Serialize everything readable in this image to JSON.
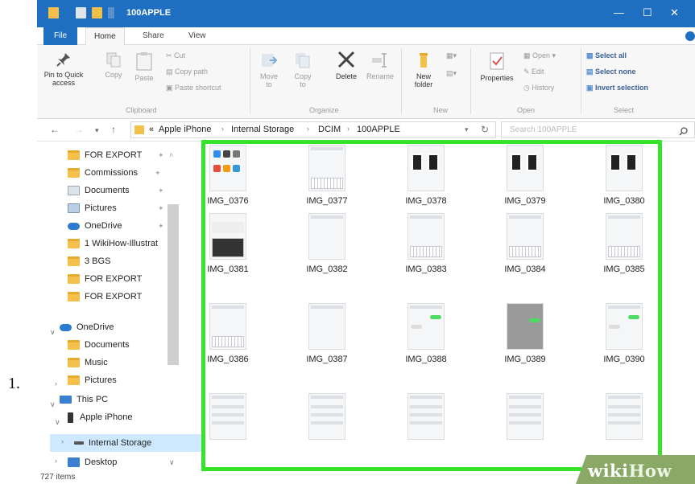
{
  "step_number": "1.",
  "window": {
    "title": "100APPLE",
    "controls": {
      "minimize": "—",
      "maximize": "☐",
      "close": "✕"
    }
  },
  "tabs": {
    "file": "File",
    "home": "Home",
    "share": "Share",
    "view": "View"
  },
  "ribbon": {
    "clipboard": {
      "group": "Clipboard",
      "pin_line1": "Pin to Quick",
      "pin_line2": "access",
      "copy": "Copy",
      "paste": "Paste",
      "cut": "Cut",
      "copy_path": "Copy path",
      "paste_shortcut": "Paste shortcut"
    },
    "organize": {
      "group": "Organize",
      "move_to_line1": "Move",
      "move_to_line2": "to",
      "copy_to_line1": "Copy",
      "copy_to_line2": "to",
      "delete": "Delete",
      "rename": "Rename"
    },
    "new": {
      "group": "New",
      "new_folder_line1": "New",
      "new_folder_line2": "folder"
    },
    "open": {
      "group": "Open",
      "properties": "Properties",
      "open": "Open",
      "edit": "Edit",
      "history": "History"
    },
    "select": {
      "group": "Select",
      "select_all": "Select all",
      "select_none": "Select none",
      "invert_selection": "Invert selection"
    }
  },
  "address": {
    "breadcrumb": [
      "Apple iPhone",
      "Internal Storage",
      "DCIM",
      "100APPLE"
    ],
    "overflow": "«",
    "search_placeholder": "Search 100APPLE"
  },
  "nav": {
    "quick_access": [
      {
        "label": "FOR EXPORT",
        "icon": "folder"
      },
      {
        "label": "Commissions",
        "icon": "folder"
      },
      {
        "label": "Documents",
        "icon": "documents"
      },
      {
        "label": "Pictures",
        "icon": "pictures"
      },
      {
        "label": "OneDrive",
        "icon": "onedrive"
      },
      {
        "label": "1 WikiHow-Illustrat",
        "icon": "folder"
      },
      {
        "label": "3 BGS",
        "icon": "folder"
      },
      {
        "label": "FOR EXPORT",
        "icon": "folder"
      },
      {
        "label": "FOR EXPORT",
        "icon": "folder"
      }
    ],
    "onedrive": {
      "label": "OneDrive",
      "children": [
        "Documents",
        "Music",
        "Pictures"
      ]
    },
    "this_pc": {
      "label": "This PC",
      "apple_iphone": "Apple iPhone",
      "internal_storage": "Internal Storage",
      "desktop": "Desktop"
    }
  },
  "files": [
    "IMG_0376",
    "IMG_0377",
    "IMG_0378",
    "IMG_0379",
    "IMG_0380",
    "IMG_0381",
    "IMG_0382",
    "IMG_0383",
    "IMG_0384",
    "IMG_0385",
    "IMG_0386",
    "IMG_0387",
    "IMG_0388",
    "IMG_0389",
    "IMG_0390"
  ],
  "status": {
    "item_count": "727 items"
  },
  "watermark": {
    "wiki": "wiki",
    "how": "How"
  },
  "colors": {
    "titlebar": "#1e6fc1",
    "highlight": "#37e22a",
    "folder": "#f4c04a",
    "selection": "#cde8ff"
  }
}
